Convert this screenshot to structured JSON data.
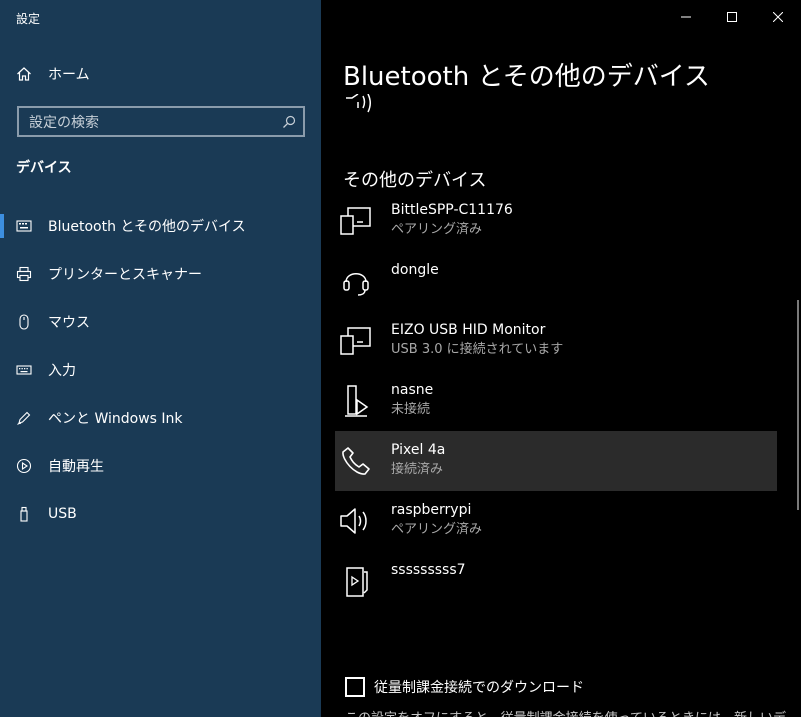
{
  "app": {
    "title": "設定"
  },
  "sidebar": {
    "home": {
      "label": "ホーム",
      "icon": "home-icon"
    },
    "search": {
      "placeholder": "設定の検索",
      "icon": "search-icon"
    },
    "section_title": "デバイス",
    "items": [
      {
        "label": "Bluetooth とその他のデバイス",
        "icon": "bluetooth-devices-icon",
        "active": true
      },
      {
        "label": "プリンターとスキャナー",
        "icon": "printer-icon",
        "active": false
      },
      {
        "label": "マウス",
        "icon": "mouse-icon",
        "active": false
      },
      {
        "label": "入力",
        "icon": "keyboard-icon",
        "active": false
      },
      {
        "label": "ペンと Windows Ink",
        "icon": "pen-icon",
        "active": false
      },
      {
        "label": "自動再生",
        "icon": "autoplay-icon",
        "active": false
      },
      {
        "label": "USB",
        "icon": "usb-icon",
        "active": false
      }
    ]
  },
  "window_controls": {
    "minimize": "minimize-icon",
    "maximize": "maximize-icon",
    "close": "close-icon"
  },
  "main": {
    "title": "Bluetooth とその他のデバイス",
    "group_title": "その他のデバイス",
    "devices": [
      {
        "name": "BittleSPP-C11176",
        "status": "ペアリング済み",
        "icon": "device-generic-icon",
        "selected": false
      },
      {
        "name": "dongle",
        "status": "",
        "icon": "headset-icon",
        "selected": false
      },
      {
        "name": "EIZO USB HID Monitor",
        "status": "USB 3.0 に接続されています",
        "icon": "device-generic-icon",
        "selected": false
      },
      {
        "name": "nasne",
        "status": "未接続",
        "icon": "media-device-icon",
        "selected": false
      },
      {
        "name": "Pixel 4a",
        "status": "接続済み",
        "icon": "phone-icon",
        "selected": true
      },
      {
        "name": "raspberrypi",
        "status": "ペアリング済み",
        "icon": "speaker-icon",
        "selected": false
      },
      {
        "name": "sssssssss7",
        "status": "",
        "icon": "media-player-icon",
        "selected": false
      }
    ],
    "metered": {
      "label": "従量制課金接続でのダウンロード",
      "checked": false
    },
    "cut_text": "この設定をオフにすると、従量制課金接続を使っているときには、新しいデ"
  },
  "colors": {
    "sidebar_bg": "#1a3a55",
    "accent": "#3d8fe0",
    "main_bg": "#000000",
    "selected_bg": "#2b2b2b"
  }
}
